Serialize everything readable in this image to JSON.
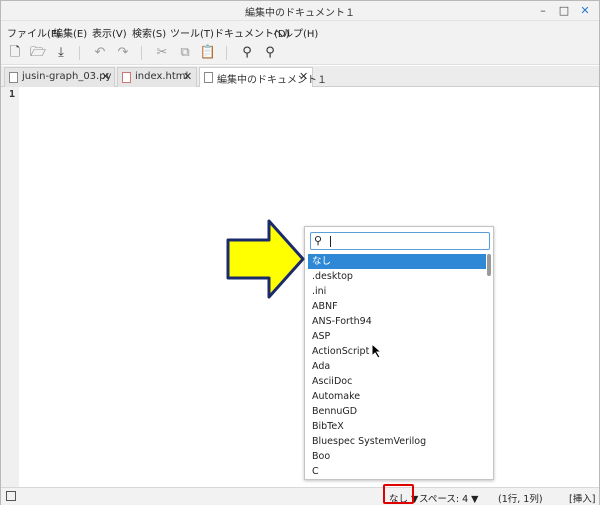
{
  "window": {
    "title": "編集中のドキュメント１"
  },
  "menu": [
    "ファイル(F)",
    "編集(E)",
    "表示(V)",
    "検索(S)",
    "ツール(T)",
    "ドキュメント(D)",
    "ヘルプ(H)"
  ],
  "tabs": [
    {
      "label": "jusin-graph_03.py",
      "icon": "python-file-icon"
    },
    {
      "label": "index.html",
      "icon": "html-file-icon"
    },
    {
      "label": "編集中のドキュメント１",
      "icon": "text-file-icon"
    }
  ],
  "editor": {
    "line_number": "1"
  },
  "dropdown": {
    "search_value": "",
    "items": [
      "なし",
      ".desktop",
      ".ini",
      "ABNF",
      "ANS-Forth94",
      "ASP",
      "ActionScript",
      "Ada",
      "AsciiDoc",
      "Automake",
      "BennuGD",
      "BibTeX",
      "Bluespec SystemVerilog",
      "Boo",
      "C"
    ],
    "selected": "なし"
  },
  "statusbar": {
    "syntax": "なし",
    "indent": "スペース: 4",
    "position": "(1行, 1列)",
    "mode": "[挿入]"
  },
  "colors": {
    "selection": "#2f88d6",
    "highlight": "#e00000",
    "arrow_fill": "#ffff00",
    "arrow_stroke": "#1a2a6b"
  }
}
